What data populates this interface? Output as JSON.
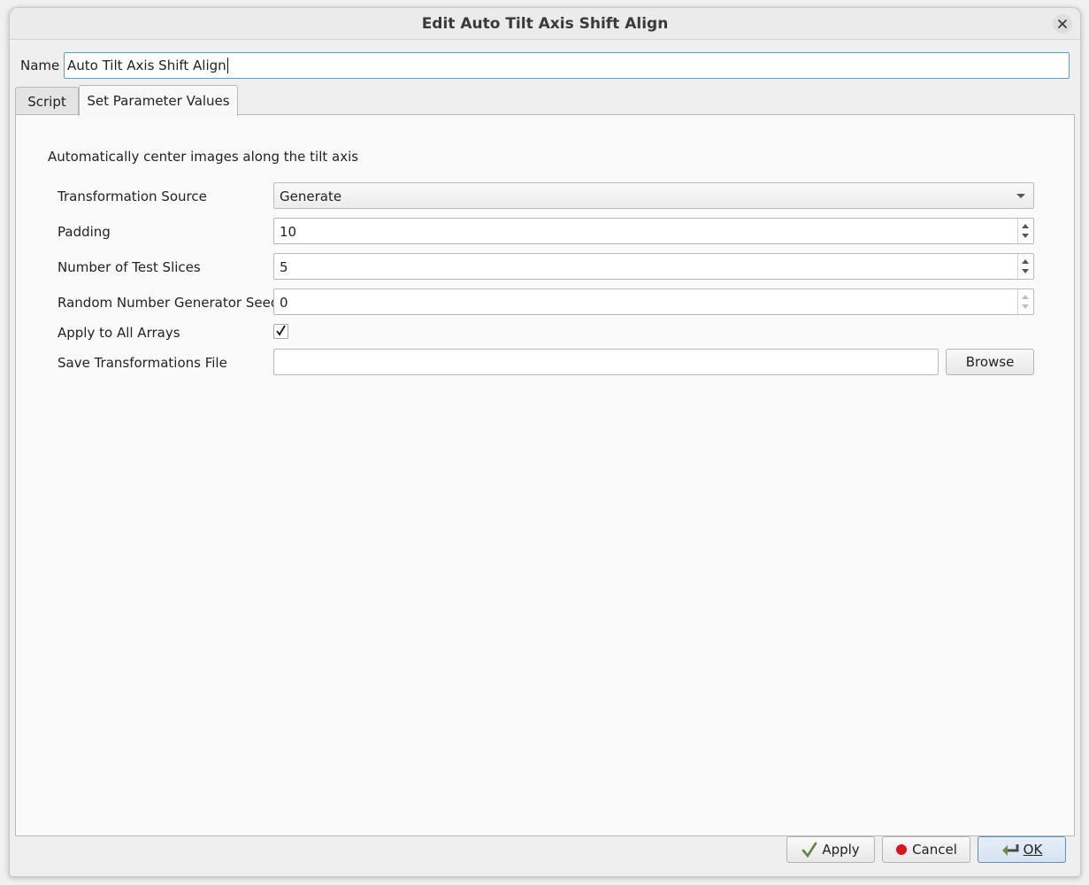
{
  "window": {
    "title": "Edit Auto Tilt Axis Shift Align"
  },
  "name_field": {
    "label": "Name",
    "value": "Auto Tilt Axis Shift Align"
  },
  "tabs": [
    {
      "label": "Script",
      "active": false
    },
    {
      "label": "Set Parameter Values",
      "active": true
    }
  ],
  "panel": {
    "description": "Automatically center images along the tilt axis",
    "rows": {
      "transformation_source": {
        "label": "Transformation Source",
        "value": "Generate"
      },
      "padding": {
        "label": "Padding",
        "value": "10"
      },
      "test_slices": {
        "label": "Number of Test Slices",
        "value": "5"
      },
      "seed": {
        "label": "Random Number Generator Seed",
        "value": "0"
      },
      "apply_all": {
        "label": "Apply to All Arrays",
        "checked": true
      },
      "save_file": {
        "label": "Save Transformations File",
        "value": "",
        "browse_label": "Browse"
      }
    }
  },
  "buttons": {
    "apply": "Apply",
    "cancel": "Cancel",
    "ok": "OK"
  },
  "icons": {
    "close": "close-icon",
    "apply": "checkmark-icon",
    "cancel": "red-dot-icon",
    "ok": "return-arrow-icon"
  },
  "colors": {
    "focus_border": "#5d9bd6",
    "cancel_dot": "#d9141b",
    "apply_check": "#5b8a3c"
  }
}
